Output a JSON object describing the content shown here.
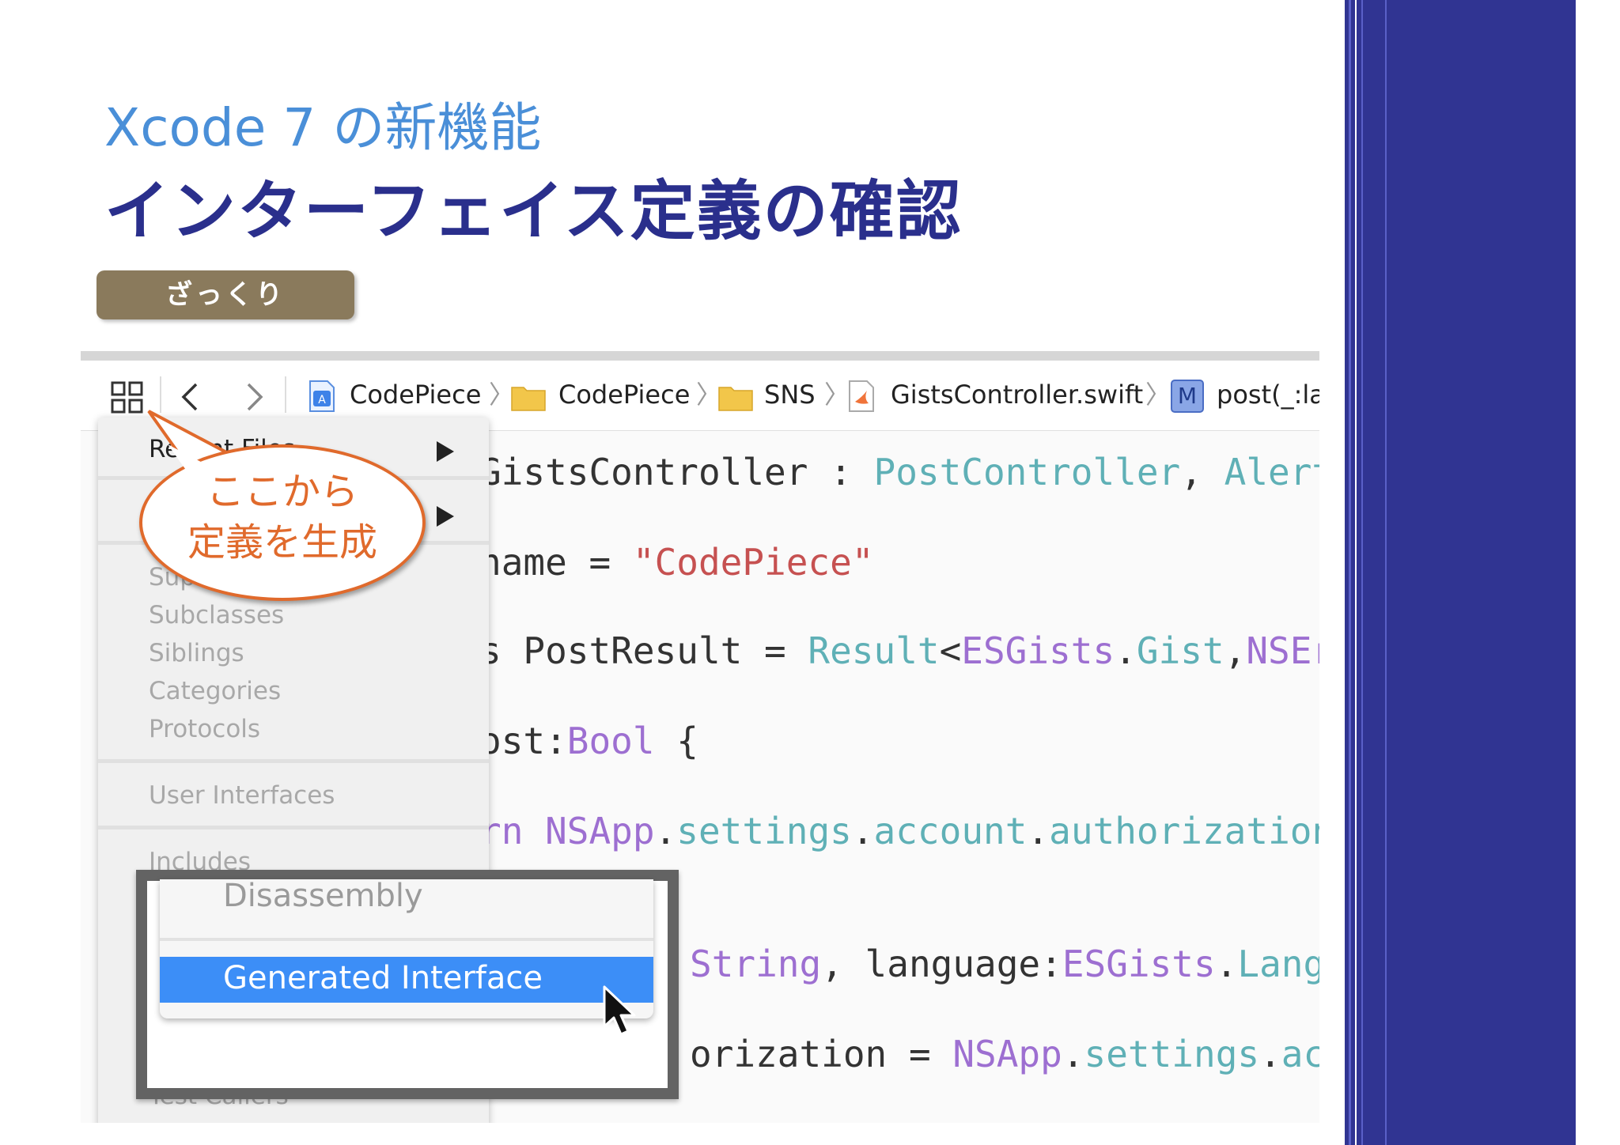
{
  "slide": {
    "subtitle": "Xcode 7 の新機能",
    "title": "インターフェイス定義の確認",
    "tag": "ざっくり"
  },
  "jumpbar": {
    "items": [
      "CodePiece",
      "CodePiece",
      "SNS",
      "GistsController.swift",
      "post(_:la"
    ],
    "method_badge": "M"
  },
  "menu": {
    "recent_files": "Recent Files",
    "superclasses": "Superclasses",
    "subclasses": "Subclasses",
    "siblings": "Siblings",
    "categories": "Categories",
    "protocols": "Protocols",
    "user_interfaces": "User Interfaces",
    "includes": "Includes",
    "test_callers": "Test Callers"
  },
  "callout": {
    "line1": "ここから",
    "line2": "定義を生成"
  },
  "submenu": {
    "disassembly": "Disassembly",
    "generated_interface": "Generated Interface"
  },
  "code": {
    "line1": {
      "a": "GistsController : ",
      "b": "PostController",
      "c": ", ",
      "d": "AlertD"
    },
    "line2": {
      "a": "name = ",
      "b": "\"CodePiece\""
    },
    "line3": {
      "a": "s PostResult = ",
      "b": "Result",
      "c": "<",
      "d": "ESGists",
      "e": ".",
      "f": "Gist",
      "g": ",",
      "h": "NSErr"
    },
    "line4": {
      "a": "ost:",
      "b": "Bool",
      "c": " {"
    },
    "line5": {
      "a": "rn ",
      "b": "NSApp",
      "c": ".",
      "d": "settings",
      "e": ".",
      "f": "account",
      "g": ".",
      "h": "authorizationS"
    },
    "line6": {
      "a": "String",
      "b": ", language:",
      "c": "ESGists",
      "d": ".",
      "e": "Langu"
    },
    "line7": {
      "a": "orization = ",
      "b": "NSApp",
      "c": ".",
      "d": "settings",
      "e": ".",
      "f": "acc"
    }
  }
}
